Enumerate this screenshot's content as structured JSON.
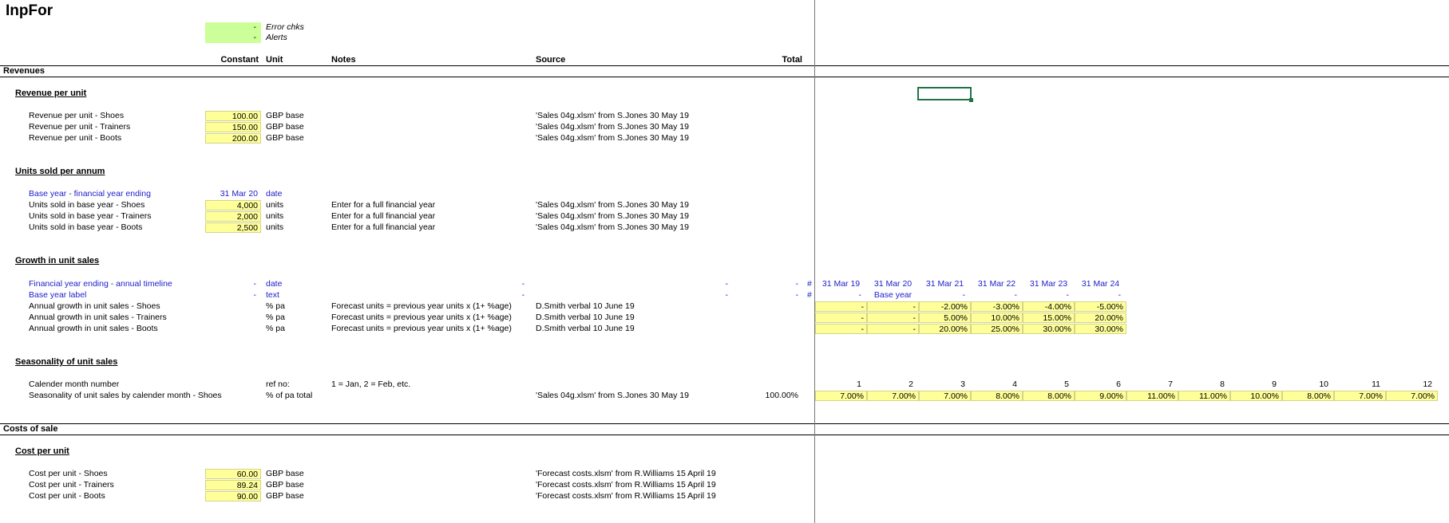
{
  "sheet": {
    "title": "InpFor",
    "checks": [
      {
        "value": "-",
        "label": "Error chks"
      },
      {
        "value": "-",
        "label": "Alerts"
      }
    ],
    "columns": {
      "constant": "Constant",
      "unit": "Unit",
      "notes": "Notes",
      "source": "Source",
      "total": "Total"
    }
  },
  "revenues": {
    "header": "Revenues",
    "revenue_per_unit": {
      "title": "Revenue per unit",
      "rows": [
        {
          "label": "Revenue per unit - Shoes",
          "value": "100.00",
          "unit": "GBP base",
          "source": "'Sales 04g.xlsm' from S.Jones 30 May 19"
        },
        {
          "label": "Revenue per unit - Trainers",
          "value": "150.00",
          "unit": "GBP base",
          "source": "'Sales 04g.xlsm' from S.Jones 30 May 19"
        },
        {
          "label": "Revenue per unit - Boots",
          "value": "200.00",
          "unit": "GBP base",
          "source": "'Sales 04g.xlsm' from S.Jones 30 May 19"
        }
      ]
    },
    "units_sold": {
      "title": "Units sold per annum",
      "base_year": {
        "label": "Base year - financial year ending",
        "value": "31 Mar 20",
        "unit": "date"
      },
      "rows": [
        {
          "label": "Units sold in base year - Shoes",
          "value": "4,000",
          "unit": "units",
          "notes": "Enter for a full financial year",
          "source": "'Sales 04g.xlsm' from S.Jones 30 May 19"
        },
        {
          "label": "Units sold in base year - Trainers",
          "value": "2,000",
          "unit": "units",
          "notes": "Enter for a full financial year",
          "source": "'Sales 04g.xlsm' from S.Jones 30 May 19"
        },
        {
          "label": "Units sold in base year - Boots",
          "value": "2,500",
          "unit": "units",
          "notes": "Enter for a full financial year",
          "source": "'Sales 04g.xlsm' from S.Jones 30 May 19"
        }
      ]
    },
    "growth": {
      "title": "Growth in unit sales",
      "timeline": {
        "label": "Financial year ending - annual timeline",
        "const": "-",
        "unit": "date",
        "notes": "-",
        "source": "-",
        "total_a": "-",
        "total_b": "-",
        "hash": "#",
        "years": [
          "31 Mar 19",
          "31 Mar 20",
          "31 Mar 21",
          "31 Mar 22",
          "31 Mar 23",
          "31 Mar 24"
        ]
      },
      "base_label": {
        "label": "Base year label",
        "const": "-",
        "unit": "text",
        "notes": "-",
        "source": "-",
        "total_a": "-",
        "total_b": "-",
        "hash": "#",
        "values": [
          "-",
          "Base year",
          "-",
          "-",
          "-",
          "-"
        ]
      },
      "rows": [
        {
          "label": "Annual growth in unit sales - Shoes",
          "unit": "% pa",
          "notes": "Forecast units =  previous year units x (1+ %age)",
          "source": "D.Smith verbal 10 June 19",
          "values": [
            "-",
            "-",
            "-2.00%",
            "-3.00%",
            "-4.00%",
            "-5.00%"
          ]
        },
        {
          "label": "Annual growth in unit sales - Trainers",
          "unit": "% pa",
          "notes": "Forecast units =  previous year units x (1+ %age)",
          "source": "D.Smith verbal 10 June 19",
          "values": [
            "-",
            "-",
            "5.00%",
            "10.00%",
            "15.00%",
            "20.00%"
          ]
        },
        {
          "label": "Annual growth in unit sales - Boots",
          "unit": "% pa",
          "notes": "Forecast units =  previous year units x (1+ %age)",
          "source": "D.Smith verbal 10 June 19",
          "values": [
            "-",
            "-",
            "20.00%",
            "25.00%",
            "30.00%",
            "30.00%"
          ]
        }
      ]
    },
    "seasonality": {
      "title": "Seasonality of unit sales",
      "month_row": {
        "label": "Calender month number",
        "unit": "ref no:",
        "notes": "1 = Jan, 2 = Feb, etc.",
        "months": [
          "1",
          "2",
          "3",
          "4",
          "5",
          "6",
          "7",
          "8",
          "9",
          "10",
          "11",
          "12"
        ]
      },
      "shoes_row": {
        "label": "Seasonality of unit sales by calender month - Shoes",
        "unit": "% of pa total",
        "source": "'Sales 04g.xlsm' from S.Jones 30 May 19",
        "total": "100.00%",
        "values": [
          "7.00%",
          "7.00%",
          "7.00%",
          "8.00%",
          "8.00%",
          "9.00%",
          "11.00%",
          "11.00%",
          "10.00%",
          "8.00%",
          "7.00%",
          "7.00%"
        ]
      }
    }
  },
  "costs": {
    "header": "Costs of sale",
    "cost_per_unit": {
      "title": "Cost per unit",
      "rows": [
        {
          "label": "Cost per unit - Shoes",
          "value": "60.00",
          "unit": "GBP base",
          "source": "'Forecast costs.xlsm' from R.Williams 15 April 19"
        },
        {
          "label": "Cost per unit - Trainers",
          "value": "89.24",
          "unit": "GBP base",
          "source": "'Forecast costs.xlsm' from R.Williams 15 April 19"
        },
        {
          "label": "Cost per unit - Boots",
          "value": "90.00",
          "unit": "GBP base",
          "source": "'Forecast costs.xlsm' from R.Williams 15 April 19"
        }
      ]
    }
  }
}
